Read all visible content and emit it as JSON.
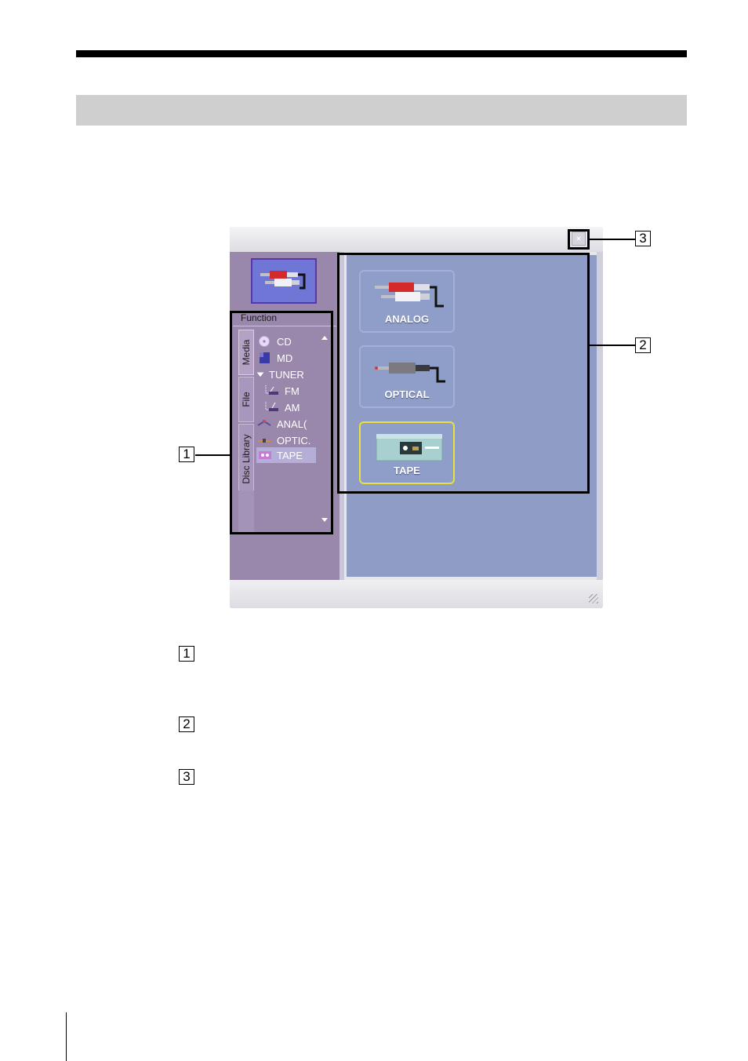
{
  "window": {
    "close_glyph": "×",
    "function_label": "Function",
    "tabs": [
      {
        "label": "Media",
        "active": true
      },
      {
        "label": "File",
        "active": false
      },
      {
        "label": "Disc Library",
        "active": false
      }
    ],
    "tree_items": [
      {
        "label": "CD",
        "icon": "cd-icon"
      },
      {
        "label": "MD",
        "icon": "md-icon"
      },
      {
        "label": "TUNER",
        "icon": "expand-triangle-icon"
      },
      {
        "label": "FM",
        "icon": "fm-antenna-icon"
      },
      {
        "label": "AM",
        "icon": "am-antenna-icon"
      },
      {
        "label": "ANAL(",
        "icon": "analog-cable-icon"
      },
      {
        "label": "OPTIC.",
        "icon": "optical-cable-icon"
      },
      {
        "label": "TAPE",
        "icon": "tape-deck-icon",
        "selected": true
      }
    ],
    "sources": [
      {
        "label": "ANALOG",
        "icon": "rca-cable-icon",
        "selected": false
      },
      {
        "label": "OPTICAL",
        "icon": "optical-cable-icon",
        "selected": false
      },
      {
        "label": "TAPE",
        "icon": "tape-deck-icon",
        "selected": true
      }
    ]
  },
  "callouts": [
    "1",
    "2",
    "3"
  ],
  "legend_numbers": [
    "1",
    "2",
    "3"
  ],
  "colors": {
    "sidebar": "#9a88ac",
    "main_pane": "#8e9cc6",
    "selection_border": "#e9e23a"
  }
}
